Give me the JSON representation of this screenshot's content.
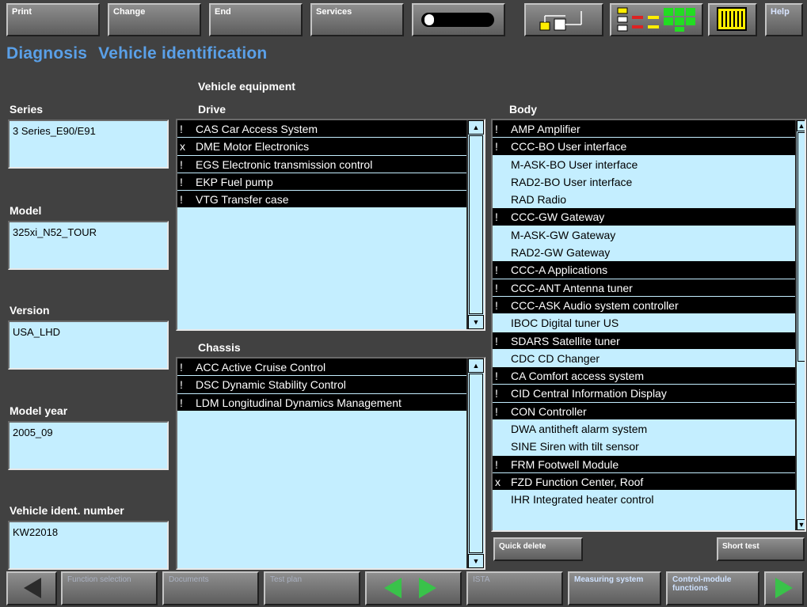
{
  "toolbar": {
    "print": "Print",
    "change": "Change",
    "end": "End",
    "services": "Services",
    "help": "Help"
  },
  "header": {
    "section": "Diagnosis",
    "title": "Vehicle identification"
  },
  "equipment_heading": "Vehicle equipment",
  "vehicle": {
    "series_label": "Series",
    "series_value": "3 Series_E90/E91",
    "model_label": "Model",
    "model_value": "325xi_N52_TOUR",
    "version_label": "Version",
    "version_value": "USA_LHD",
    "year_label": "Model year",
    "year_value": "2005_09",
    "vin_label": "Vehicle ident. number",
    "vin_value": "KW22018"
  },
  "drive": {
    "label": "Drive",
    "items": [
      {
        "mark": "!",
        "text": "CAS Car Access System",
        "dark": true
      },
      {
        "mark": "x",
        "text": "DME Motor Electronics",
        "dark": true
      },
      {
        "mark": "!",
        "text": "EGS Electronic transmission control",
        "dark": true
      },
      {
        "mark": "!",
        "text": "EKP Fuel pump",
        "dark": true
      },
      {
        "mark": "!",
        "text": "VTG Transfer case",
        "dark": true
      }
    ]
  },
  "chassis": {
    "label": "Chassis",
    "items": [
      {
        "mark": "!",
        "text": "ACC Active Cruise Control",
        "dark": true
      },
      {
        "mark": "!",
        "text": "DSC Dynamic Stability Control",
        "dark": true
      },
      {
        "mark": "!",
        "text": "LDM Longitudinal Dynamics Management",
        "dark": true
      }
    ]
  },
  "body_group": {
    "label": "Body",
    "items": [
      {
        "mark": "!",
        "text": "AMP Amplifier",
        "dark": true
      },
      {
        "mark": "!",
        "text": "CCC-BO User interface",
        "dark": true
      },
      {
        "mark": "",
        "text": "M-ASK-BO User interface",
        "dark": false
      },
      {
        "mark": "",
        "text": "RAD2-BO User interface",
        "dark": false
      },
      {
        "mark": "",
        "text": "RAD Radio",
        "dark": false
      },
      {
        "mark": "!",
        "text": "CCC-GW Gateway",
        "dark": true
      },
      {
        "mark": "",
        "text": "M-ASK-GW Gateway",
        "dark": false
      },
      {
        "mark": "",
        "text": "RAD2-GW Gateway",
        "dark": false
      },
      {
        "mark": "!",
        "text": "CCC-A Applications",
        "dark": true
      },
      {
        "mark": "!",
        "text": "CCC-ANT Antenna tuner",
        "dark": true
      },
      {
        "mark": "!",
        "text": "CCC-ASK Audio system controller",
        "dark": true
      },
      {
        "mark": "",
        "text": "IBOC Digital tuner US",
        "dark": false
      },
      {
        "mark": "!",
        "text": "SDARS Satellite tuner",
        "dark": true
      },
      {
        "mark": "",
        "text": "CDC CD Changer",
        "dark": false
      },
      {
        "mark": "!",
        "text": "CA Comfort access system",
        "dark": true
      },
      {
        "mark": "!",
        "text": "CID Central Information Display",
        "dark": true
      },
      {
        "mark": "!",
        "text": "CON Controller",
        "dark": true
      },
      {
        "mark": "",
        "text": "DWA antitheft alarm system",
        "dark": false
      },
      {
        "mark": "",
        "text": "SINE Siren with tilt sensor",
        "dark": false
      },
      {
        "mark": "!",
        "text": "FRM Footwell Module",
        "dark": true
      },
      {
        "mark": "x",
        "text": "FZD Function Center, Roof",
        "dark": true
      },
      {
        "mark": "",
        "text": "IHR Integrated heater control",
        "dark": false
      }
    ]
  },
  "actions": {
    "quick_delete": "Quick delete",
    "short_test": "Short test"
  },
  "bottom": {
    "function_selection": "Function selection",
    "documents": "Documents",
    "test_plan": "Test plan",
    "ist": "ISTA",
    "measuring_system": "Measuring system",
    "control_module_functions": "Control-module functions"
  },
  "colors": {
    "accent_title": "#5aa0e8",
    "panel_bg": "#c4eeff",
    "indicator_green": "#22dd22",
    "indicator_yellow": "#ffee00",
    "indicator_red": "#dd2222"
  }
}
